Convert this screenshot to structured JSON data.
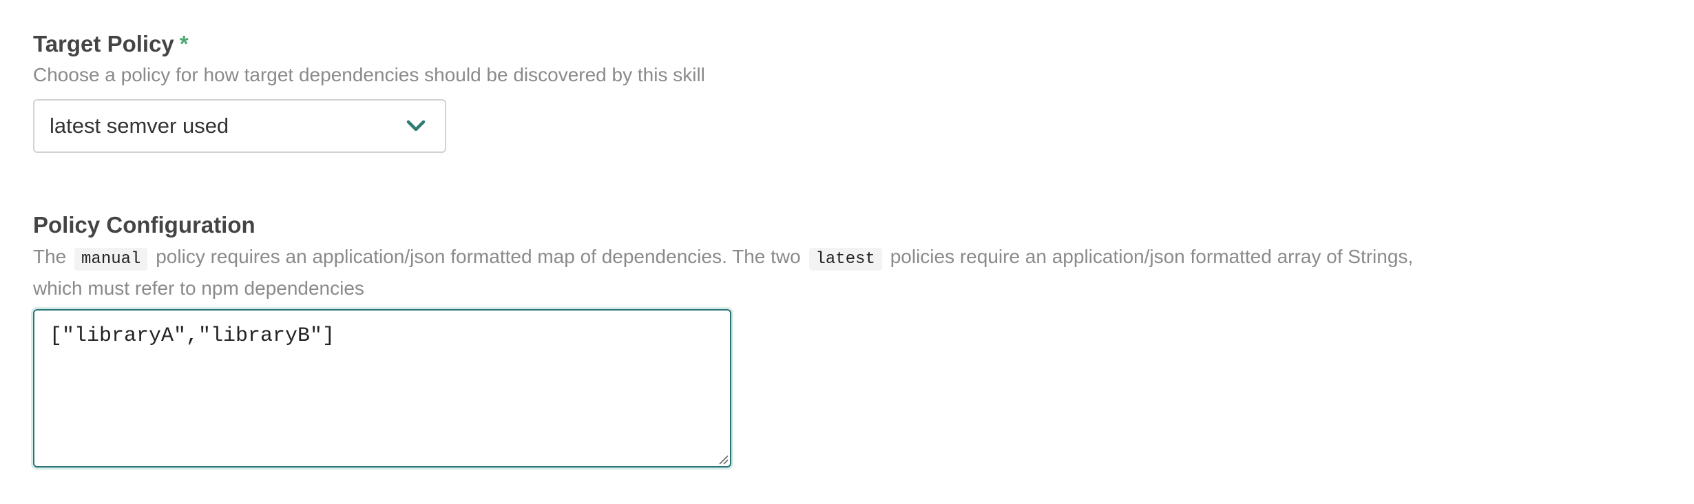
{
  "target_policy": {
    "title": "Target Policy",
    "required_mark": "*",
    "description": "Choose a policy for how target dependencies should be discovered by this skill",
    "select": {
      "selected_value": "latest semver used",
      "icon": "chevron-down-icon"
    }
  },
  "policy_configuration": {
    "title": "Policy Configuration",
    "description": {
      "part1": "The",
      "code1": "manual",
      "part2": "policy requires an application/json formatted map of dependencies. The two",
      "code2": "latest",
      "part3": "policies require an application/json formatted array of Strings,",
      "part4": "which must refer to npm dependencies"
    },
    "textarea": {
      "value": "[\"libraryA\",\"libraryB\"]"
    }
  },
  "colors": {
    "accent": "#2a7377",
    "required": "#4fa872",
    "chevron": "#2f7b73"
  }
}
